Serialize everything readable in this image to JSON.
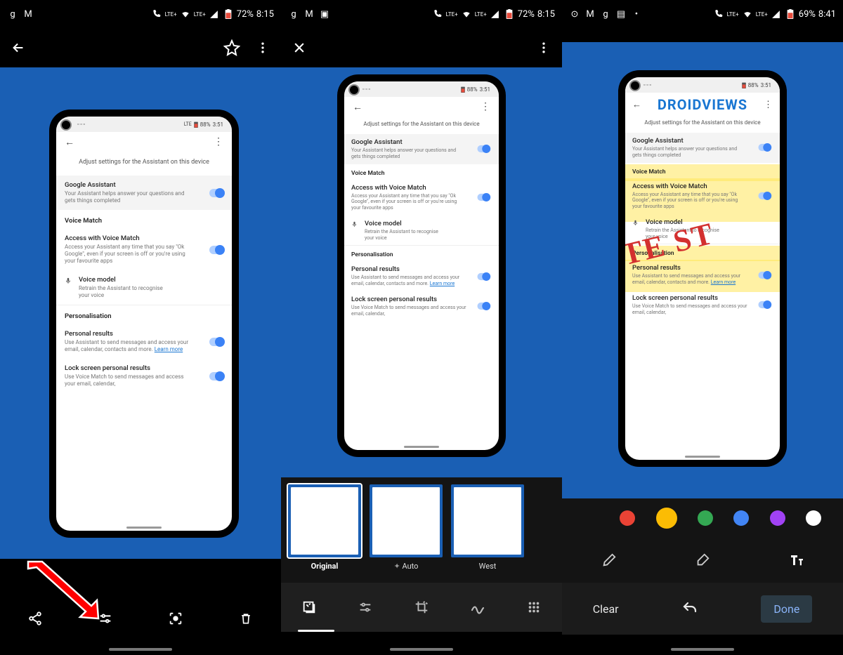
{
  "status": {
    "p1": {
      "battery": "72%",
      "time": "8:15",
      "net": "LTE+"
    },
    "p2": {
      "battery": "72%",
      "time": "8:15",
      "net": "LTE+"
    },
    "p3": {
      "battery": "69%",
      "time": "8:41",
      "net": "LTE+"
    }
  },
  "phone_status": {
    "battery": "88%",
    "time": "3:51"
  },
  "settings": {
    "header": "Adjust settings for the Assistant on this device",
    "ga_title": "Google Assistant",
    "ga_sub": "Your Assistant helps answer your questions and gets things completed",
    "voice_match_section": "Voice Match",
    "access_title": "Access with Voice Match",
    "access_sub": "Access your Assistant any time that you say \"Ok Google\", even if your screen is off or you're using your favourite apps",
    "voice_model_title": "Voice model",
    "voice_model_sub": "Retrain the Assistant to recognise your voice",
    "personalisation_section": "Personalisation",
    "personal_results_title": "Personal results",
    "personal_results_sub_a": "Use Assistant to send messages and access your email, calendar, contacts and more. ",
    "learn_more": "Learn more",
    "lock_title": "Lock screen personal results",
    "lock_sub": "Use Voice Match to send messages and access your email, calendar,"
  },
  "filters": {
    "original": "Original",
    "auto": "Auto",
    "west": "West"
  },
  "annotations": {
    "droidviews": "DROIDVIEWS",
    "test": "TE ST"
  },
  "colors": {
    "black": "#000000",
    "red": "#ea4335",
    "yellow": "#fbbc04",
    "green": "#34a853",
    "blue": "#4285f4",
    "purple": "#a142f4",
    "white": "#ffffff"
  },
  "actions": {
    "clear": "Clear",
    "done": "Done"
  }
}
